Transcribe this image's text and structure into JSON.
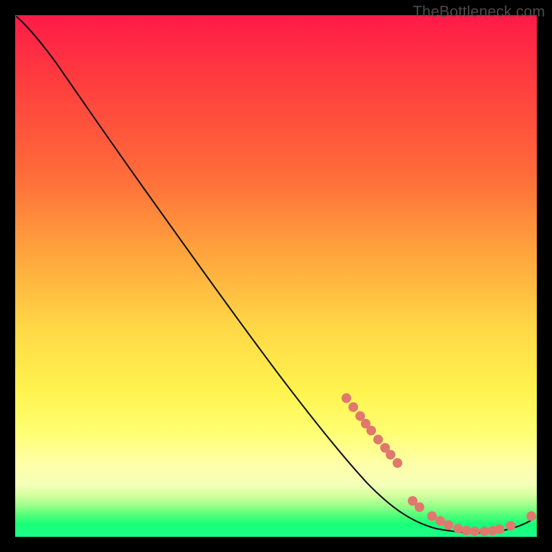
{
  "watermark": "TheBottleneck.com",
  "chart_data": {
    "type": "line",
    "title": "",
    "xlabel": "",
    "ylabel": "",
    "xlim": [
      0,
      100
    ],
    "ylim": [
      0,
      100
    ],
    "grid": false,
    "legend": false,
    "series": [
      {
        "name": "bottleneck-curve",
        "x": [
          0,
          4,
          8,
          12,
          16,
          20,
          24,
          28,
          32,
          36,
          40,
          44,
          48,
          52,
          56,
          60,
          64,
          68,
          72,
          76,
          80,
          84,
          88,
          92,
          96,
          100
        ],
        "y": [
          100,
          97,
          93,
          88,
          82,
          76,
          70,
          64,
          58,
          52,
          46,
          40,
          35,
          30,
          25,
          21,
          17,
          13,
          10,
          7,
          4,
          2,
          1,
          1,
          2,
          4
        ]
      }
    ],
    "markers": {
      "name": "highlight",
      "color": "#e0786d",
      "x": [
        64,
        65.5,
        67,
        68,
        69,
        70.5,
        72,
        73,
        74.5,
        76,
        77.5,
        80,
        81.5,
        83,
        85,
        86.5,
        88,
        90,
        91.5,
        93,
        95,
        97
      ],
      "y": [
        26,
        24.8,
        23.6,
        22.6,
        21.8,
        20.4,
        19.2,
        18.2,
        16.8,
        7,
        6,
        4,
        3,
        2.2,
        1.6,
        1.2,
        1,
        1,
        1.2,
        1.4,
        2,
        2.8
      ]
    }
  }
}
